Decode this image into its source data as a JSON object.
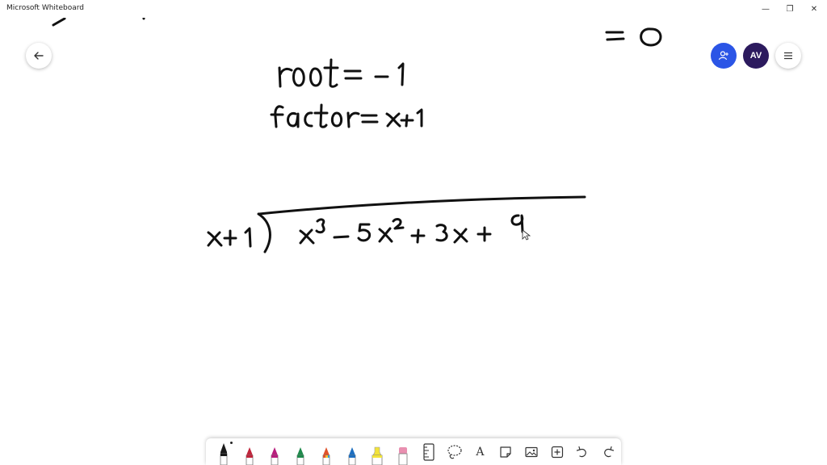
{
  "window": {
    "title": "Microsoft Whiteboard",
    "minimize_glyph": "—",
    "restore_glyph": "❐",
    "close_glyph": "✕"
  },
  "header": {
    "avatar_initials": "AV",
    "back_icon": "arrow-left-icon",
    "share_icon": "invite-person-icon",
    "menu_icon": "hamburger-menu-icon",
    "share_color": "#2b55e6",
    "avatar_color": "#2c1a5e"
  },
  "ink": {
    "equals_zero": "= 0",
    "root_line": "root = -1",
    "factor_line": "factor = x+1",
    "divisor": "x+1",
    "dividend": "x³ − 5x² + 3x + 9",
    "ink_color": "#111111"
  },
  "toolbar": {
    "tools": [
      {
        "name": "black-pen",
        "color": "#1a1a1a",
        "selected": true
      },
      {
        "name": "red-pen",
        "color": "#c0263c"
      },
      {
        "name": "magenta-pen",
        "color": "#b81e7d"
      },
      {
        "name": "green-pen",
        "color": "#1f8a4c"
      },
      {
        "name": "rainbow-pen",
        "color": "#e0532b"
      },
      {
        "name": "blue-pen",
        "color": "#1e6fc0"
      },
      {
        "name": "yellow-highlighter",
        "color": "#f2e33a"
      },
      {
        "name": "eraser",
        "color": "#e98fb0"
      }
    ],
    "actions": [
      "ruler-icon",
      "lasso-icon",
      "text-icon",
      "sticky-note-icon",
      "image-icon",
      "insert-icon",
      "undo-icon",
      "redo-icon"
    ],
    "text_tool_glyph": "A"
  }
}
